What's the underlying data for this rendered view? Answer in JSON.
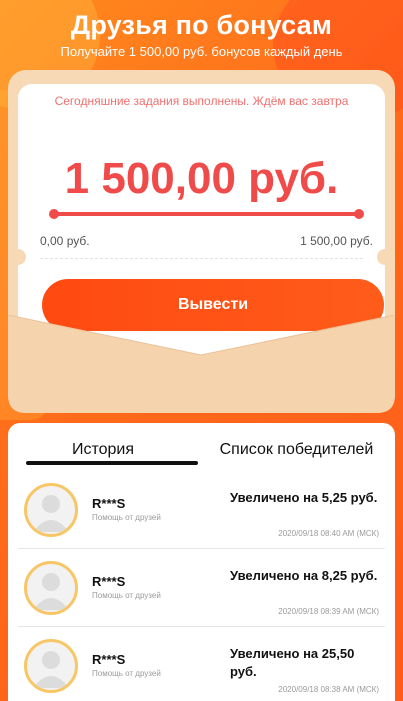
{
  "header": {
    "title": "Друзья по бонусам",
    "subtitle": "Получайте 1 500,00 руб. бонусов каждый день"
  },
  "card": {
    "status_text": "Сегодняшние задания выполнены. Ждём вас завтра",
    "amount": "1 500,00 руб.",
    "progress_min": "0,00 руб.",
    "progress_max": "1 500,00 руб.",
    "progress_fraction": 1.0,
    "withdraw_label": "Вывести"
  },
  "tabs": {
    "history": "История",
    "winners": "Список победителей",
    "active": "history"
  },
  "records": [
    {
      "name": "R***S",
      "source": "Помощь от друзей",
      "increase": "Увеличено на 5,25 руб.",
      "time": "2020/09/18 08:40 AM (МСК)"
    },
    {
      "name": "R***S",
      "source": "Помощь от друзей",
      "increase": "Увеличено на 8,25 руб.",
      "time": "2020/09/18 08:39 AM (МСК)"
    },
    {
      "name": "R***S",
      "source": "Помощь от друзей",
      "increase": "Увеличено на 25,50 руб.",
      "time": "2020/09/18 08:38 AM (МСК)"
    }
  ],
  "colors": {
    "accent": "#f04b4b",
    "button": "#ff4a12",
    "avatar_border": "#f7c666"
  }
}
